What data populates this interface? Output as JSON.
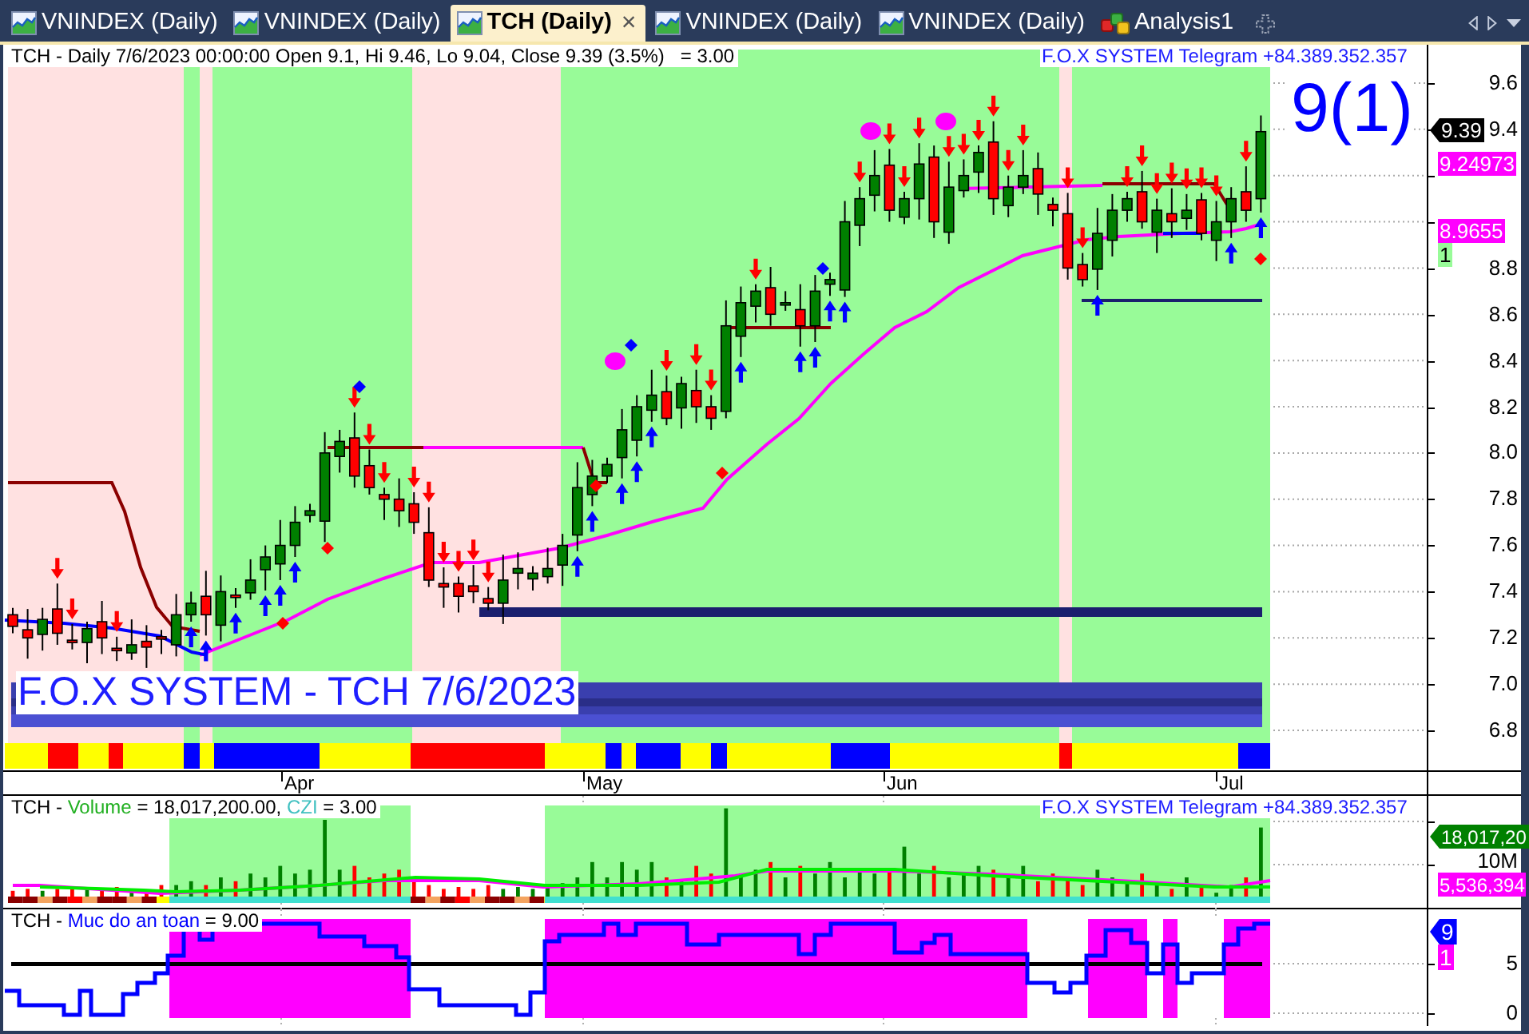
{
  "tabs": [
    {
      "label": "VNINDEX (Daily)",
      "kind": "chart",
      "selected": false
    },
    {
      "label": "VNINDEX (Daily)",
      "kind": "chart",
      "selected": false
    },
    {
      "label": "TCH (Daily)",
      "kind": "chart",
      "selected": true,
      "close": "×"
    },
    {
      "label": "VNINDEX (Daily)",
      "kind": "chart",
      "selected": false
    },
    {
      "label": "VNINDEX (Daily)",
      "kind": "chart",
      "selected": false
    },
    {
      "label": "Analysis1",
      "kind": "analysis",
      "selected": false
    }
  ],
  "price_pane": {
    "legend": "TCH - Daily 7/6/2023 00:00:00 Open 9.1, Hi 9.46, Lo 9.04, Close 9.39 (3.5%)   = 3.00",
    "banner": "F.O.X SYSTEM Telegram +84.389.352.357",
    "signal": "9(1)",
    "title": "F.O.X SYSTEM - TCH 7/6/2023",
    "axis_labels": [
      [
        "9.6",
        "9.4"
      ],
      [
        "8.8",
        "8.6",
        "8.4",
        "8.2",
        "8.0",
        "7.8",
        "7.6",
        "7.4",
        "7.2",
        "7.0",
        "6.8"
      ]
    ],
    "tags": [
      {
        "text": "9.39",
        "kind": "pointer",
        "color": "#000000"
      },
      {
        "text": "9.24973",
        "kind": "box",
        "color": "#ff00ff"
      },
      {
        "text": "8.9655",
        "kind": "box",
        "color": "#ff00ff"
      },
      {
        "text": "1",
        "kind": "box",
        "color": "#98fb98"
      }
    ]
  },
  "date_axis": {
    "labels": [
      "Apr",
      "May",
      "Jun",
      "Jul"
    ]
  },
  "volume_pane": {
    "legend": [
      {
        "text": "TCH - "
      },
      {
        "text": "Volume",
        "color": "#22b022"
      },
      {
        "text": " = 18,017,200.00, "
      },
      {
        "text": "CZI",
        "color": "#40c0c0"
      },
      {
        "text": " = 3.00"
      }
    ],
    "banner": "F.O.X SYSTEM Telegram +84.389.352.357",
    "axis_labels": [
      "10M"
    ],
    "tags": [
      {
        "text": "18,017,20",
        "kind": "pointer",
        "color": "#008000"
      },
      {
        "text": "5,536,394",
        "kind": "box",
        "color": "#ff00ff"
      }
    ]
  },
  "safety_pane": {
    "legend": [
      {
        "text": "TCH - "
      },
      {
        "text": "Muc do an toan",
        "color": "#0000ff"
      },
      {
        "text": " = 9.00"
      }
    ],
    "axis_labels": [
      "5",
      "0"
    ],
    "tags": [
      {
        "text": "9",
        "kind": "pointer",
        "color": "#0000ff"
      },
      {
        "text": "1",
        "kind": "box",
        "color": "#ff00ff"
      }
    ]
  }
}
